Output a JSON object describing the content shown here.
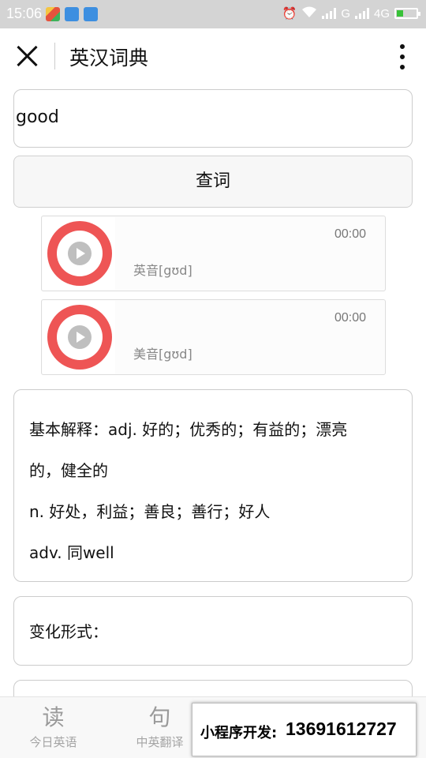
{
  "status_bar": {
    "time": "15:06",
    "network_1": "G",
    "network_2": "4G",
    "battery_color": "#38c238"
  },
  "nav": {
    "title": "英汉词典",
    "close_icon": "close-icon",
    "more_icon": "more-vertical-icon"
  },
  "search": {
    "value": "good",
    "button_label": "查词"
  },
  "pronunciations": [
    {
      "label": "英音[gʊd]",
      "duration": "00:00"
    },
    {
      "label": "美音[gʊd]",
      "duration": "00:00"
    }
  ],
  "definition": {
    "lines": [
      "基本解释：adj. 好的；优秀的；有益的；漂亮",
      "的，健全的",
      "n. 好处，利益；善良；善行；好人",
      "adv. 同well"
    ]
  },
  "forms": {
    "label": "变化形式："
  },
  "tabs": [
    {
      "glyph": "读",
      "label": "今日英语"
    },
    {
      "glyph": "句",
      "label": "中英翻译"
    }
  ],
  "promo": {
    "label": "小程序开发:",
    "phone": "13691612727"
  },
  "colors": {
    "accent_ring": "#ee5555",
    "status_bar_bg": "#d4d4d4"
  }
}
